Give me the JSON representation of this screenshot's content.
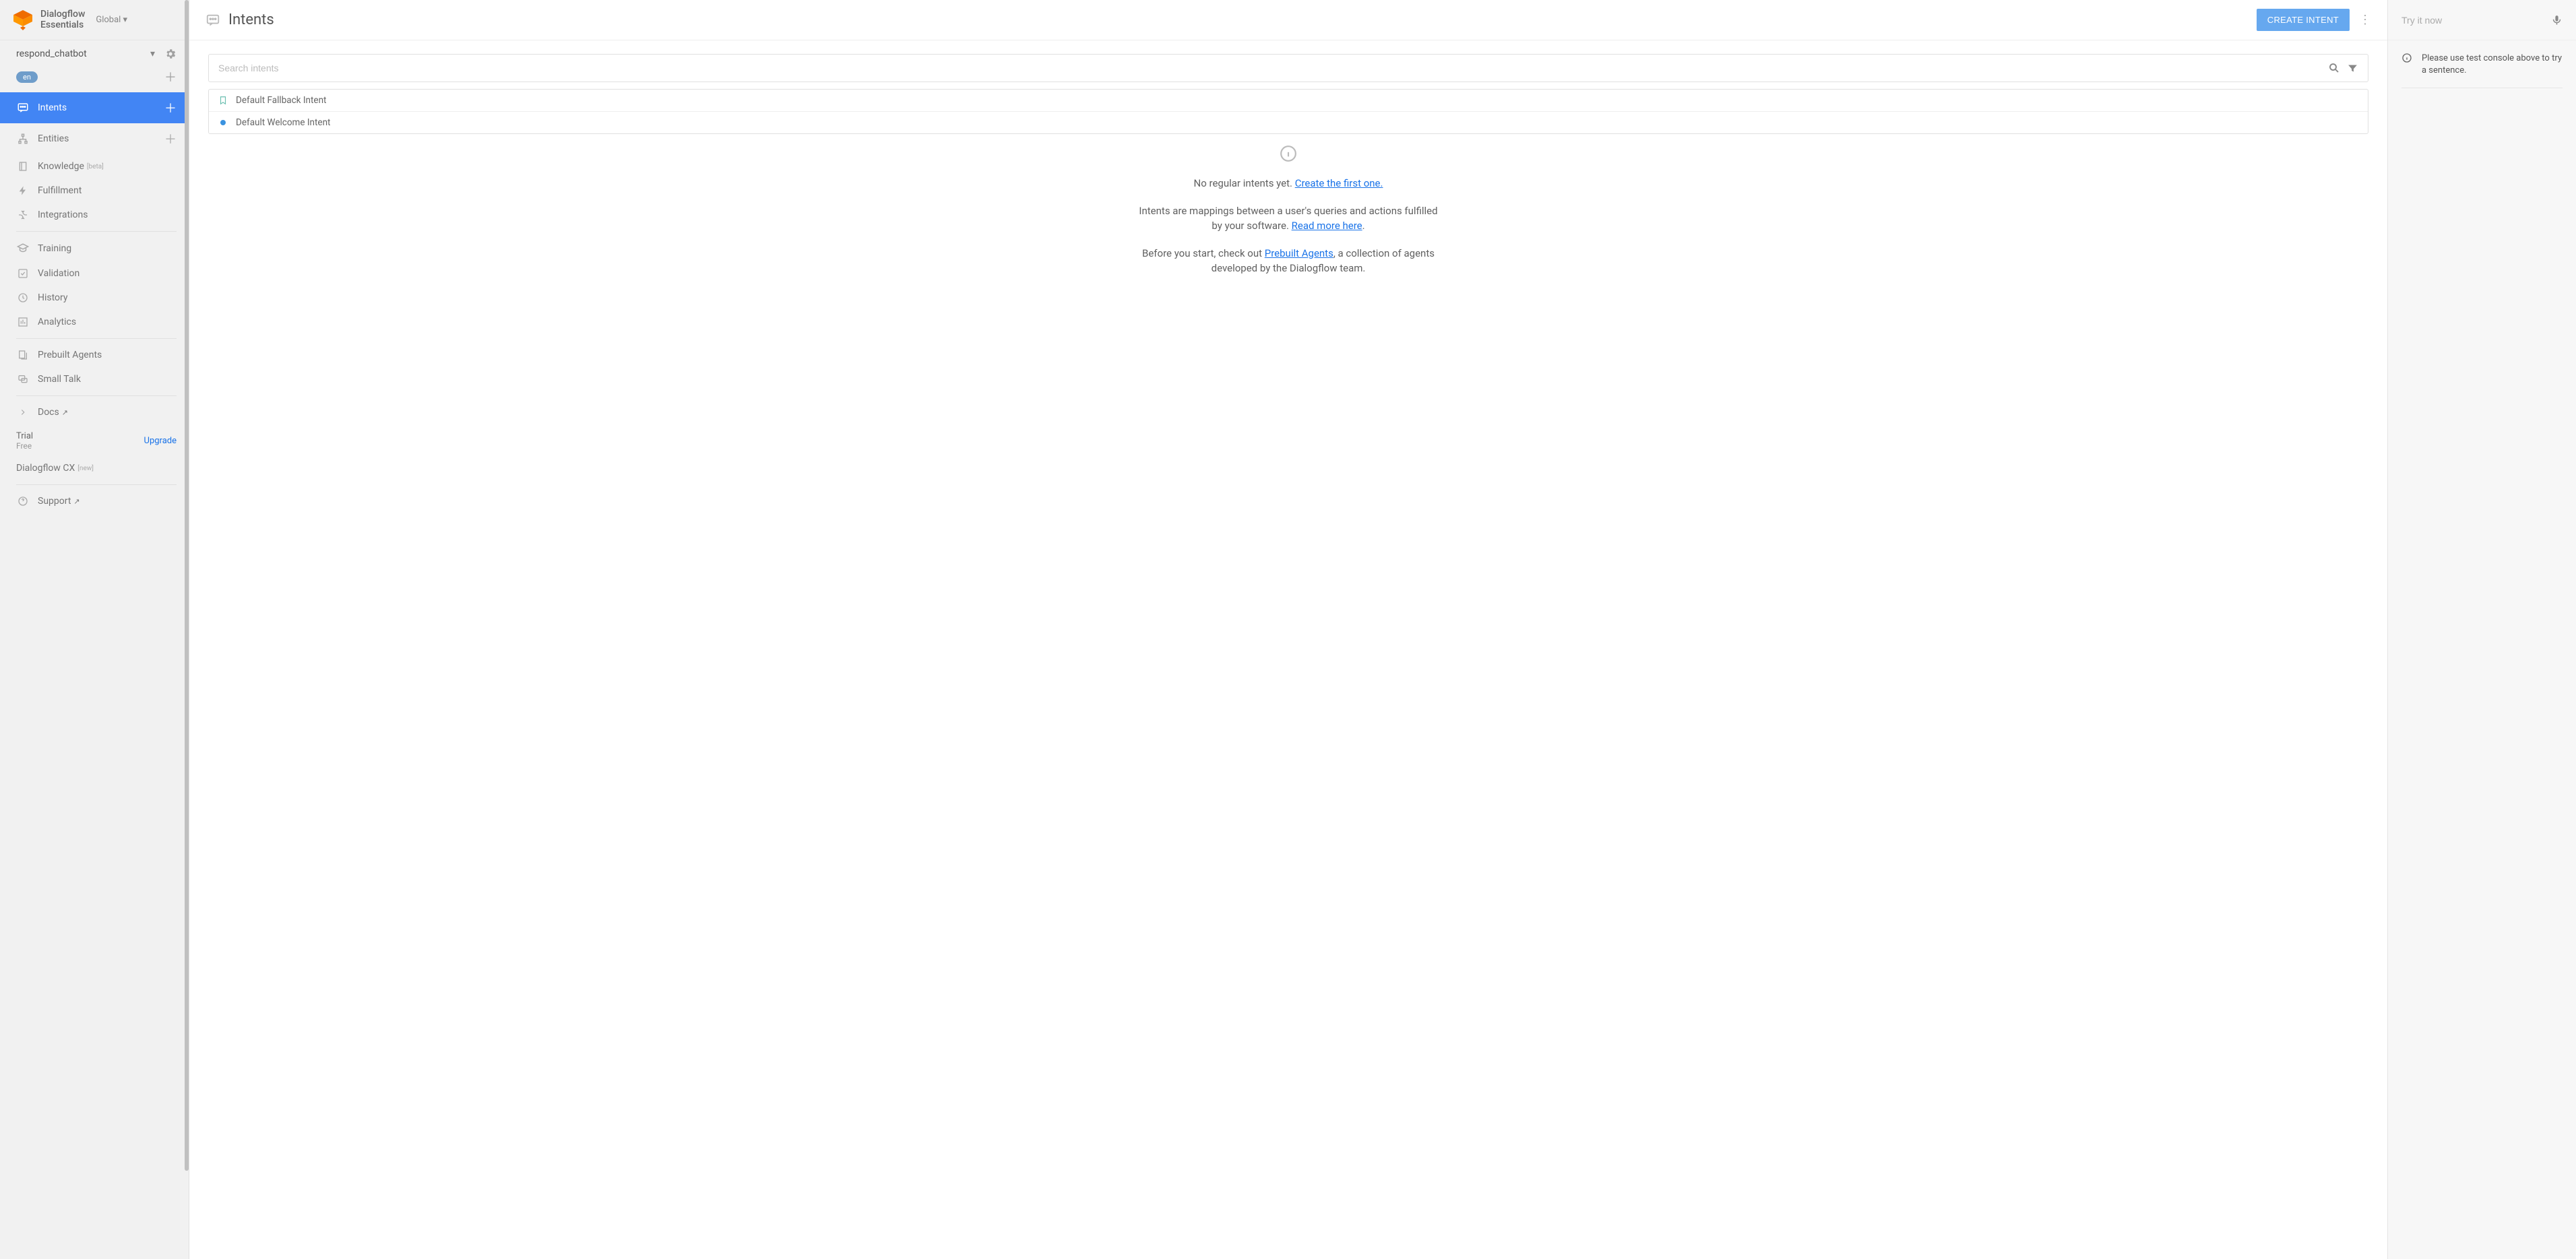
{
  "brand": {
    "line1": "Dialogflow",
    "line2": "Essentials"
  },
  "region": "Global",
  "agent": {
    "name": "respond_chatbot",
    "lang": "en"
  },
  "nav": {
    "intents": "Intents",
    "entities": "Entities",
    "knowledge": "Knowledge",
    "knowledge_badge": "[beta]",
    "fulfillment": "Fulfillment",
    "integrations": "Integrations",
    "training": "Training",
    "validation": "Validation",
    "history": "History",
    "analytics": "Analytics",
    "prebuilt": "Prebuilt Agents",
    "smalltalk": "Small Talk",
    "docs": "Docs",
    "support": "Support"
  },
  "plan": {
    "trial": "Trial",
    "free": "Free",
    "upgrade": "Upgrade",
    "cx": "Dialogflow CX",
    "cx_badge": "[new]"
  },
  "header": {
    "title": "Intents",
    "create": "CREATE INTENT"
  },
  "search": {
    "placeholder": "Search intents"
  },
  "intents": [
    {
      "name": "Default Fallback Intent",
      "kind": "fallback"
    },
    {
      "name": "Default Welcome Intent",
      "kind": "welcome"
    }
  ],
  "empty": {
    "line1_prefix": "No regular intents yet. ",
    "line1_link": "Create the first one.",
    "line2_prefix": "Intents are mappings between a user's queries and actions fulfilled by your software. ",
    "line2_link": "Read more here",
    "line2_suffix": ".",
    "line3_prefix": "Before you start, check out ",
    "line3_link": "Prebuilt Agents",
    "line3_suffix": ", a collection of agents developed by the Dialogflow team."
  },
  "test": {
    "placeholder": "Try it now",
    "hint": "Please use test console above to try a sentence."
  }
}
